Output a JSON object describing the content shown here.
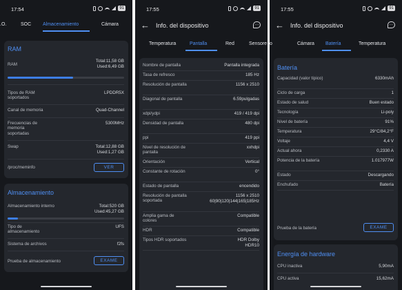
{
  "screens": [
    {
      "status": {
        "time": "17:54",
        "battery": "91"
      },
      "tabs": [
        {
          "label": ".O."
        },
        {
          "label": "SOC"
        },
        {
          "label": "Almacenamiento"
        },
        {
          "label": "Cámara"
        }
      ],
      "ram": {
        "title": "RAM",
        "label": "RAM",
        "total": "Total:11,58 GB",
        "used": "Used:6,49 GB",
        "usage_fraction": 0.56,
        "rows": [
          {
            "label": "Tipos de RAM soportados",
            "value": "LPDDR5X"
          },
          {
            "label": "Canal de memoria",
            "value": "Quad-Channel"
          },
          {
            "label": "Frecuencias de memoria soportadas",
            "value": "5300MHz"
          }
        ],
        "swap": {
          "label": "Swap",
          "total": "Total:12,88 GB",
          "used": "Used:1,27 GB"
        },
        "meminfo": {
          "label": "/proc/meminfo",
          "button": "VER"
        }
      },
      "storage": {
        "title": "Almacenamiento",
        "internal_label": "Almacenamiento interno",
        "total": "Total:520 GB",
        "used": "Used:45,27 GB",
        "usage_fraction": 0.09,
        "rows": [
          {
            "label": "Tipo de almacenamiento",
            "value": "UFS"
          },
          {
            "label": "Sistema de archivos",
            "value": "f2fs"
          }
        ],
        "test": {
          "label": "Prueba de almacenamiento",
          "button": "EXAME"
        }
      }
    },
    {
      "status": {
        "time": "17:55",
        "battery": "91"
      },
      "title": "Info. del dispositivo",
      "tabs": [
        {
          "label": "Temperatura"
        },
        {
          "label": "Pantalla"
        },
        {
          "label": "Red"
        },
        {
          "label": "Sensore"
        }
      ],
      "rows": [
        {
          "label": "Nombre de pantalla",
          "value": "Pantalla integrada"
        },
        {
          "label": "Tasa de refresco",
          "value": "185 Hz"
        },
        {
          "label": "Resolución de pantalla",
          "value": "1156 x 2510"
        },
        {
          "label": "Diagonal de pantalla",
          "value": "6.59pulgadas"
        },
        {
          "label": "xdpi/ydpi",
          "value": "419 / 419 dpi"
        },
        {
          "label": "Densidad de pantalla",
          "value": "480 dpi"
        },
        {
          "label": "ppi",
          "value": "419 ppi"
        },
        {
          "label": "Nivel de resolución de pantalla",
          "value": "xxhdpi"
        },
        {
          "label": "Orientación",
          "value": "Vertical"
        },
        {
          "label": "Constante de rotación",
          "value": "0°"
        },
        {
          "label": "Estado de pantalla",
          "value": "encendido"
        },
        {
          "label": "Resolución de pantalla soportada",
          "value": "1156 x 2510",
          "value2": "60|90|120|144|165|185Hz"
        },
        {
          "label": "Amplia gama de colores",
          "value": "Compatible"
        },
        {
          "label": "HDR",
          "value": "Compatible"
        },
        {
          "label": "Tipos HDR soportados",
          "value": "HDR Dolby",
          "value2": "HDR10"
        }
      ]
    },
    {
      "status": {
        "time": "17:55",
        "battery": "91"
      },
      "title": "Info. del dispositivo",
      "tabs": [
        {
          "label": "o"
        },
        {
          "label": "Cámara"
        },
        {
          "label": "Batería"
        },
        {
          "label": "Temperatura"
        }
      ],
      "battery": {
        "title": "Batería",
        "rows": [
          {
            "label": "Capacidad (valor típico)",
            "value": "6330mAh"
          },
          {
            "label": "Ciclo de carga",
            "value": "1"
          },
          {
            "label": "Estado de salud",
            "value": "Buen estado"
          },
          {
            "label": "Tecnología",
            "value": "Li-poly"
          },
          {
            "label": "Nivel de batería",
            "value": "91%"
          },
          {
            "label": "Temperatura",
            "value": "29°C/84,2°F"
          },
          {
            "label": "Voltaje",
            "value": "4,4 V"
          },
          {
            "label": "Actual ahora",
            "value": "0,2330 A"
          },
          {
            "label": "Potencia de la batería",
            "value": "1.017977W"
          },
          {
            "label": "Estado",
            "value": "Descargando"
          },
          {
            "label": "Enchufado",
            "value": "Batería"
          }
        ],
        "test": {
          "label": "Prueba de la batería",
          "button": "EXAME"
        }
      },
      "energy": {
        "title": "Energía de hardware",
        "rows": [
          {
            "label": "CPU inactiva",
            "value": "5,90mA"
          },
          {
            "label": "CPU activa",
            "value": "15,62mA"
          }
        ]
      }
    }
  ]
}
